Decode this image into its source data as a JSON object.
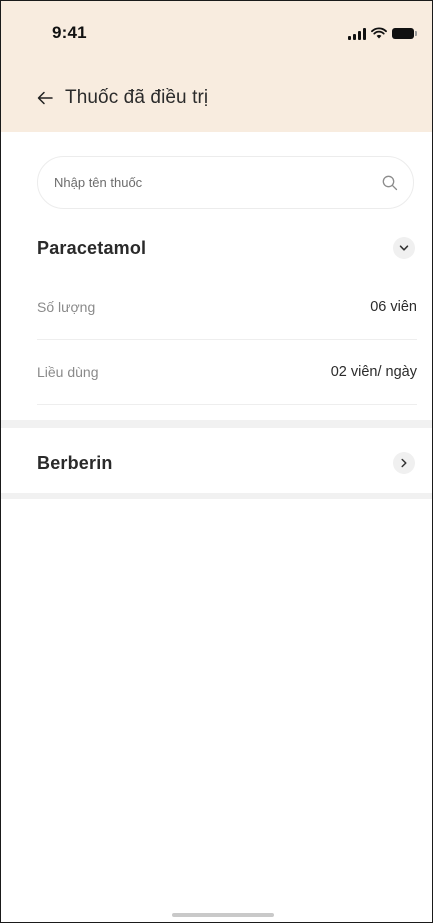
{
  "status_bar": {
    "time": "9:41",
    "icons": [
      "signal-icon",
      "wifi-icon",
      "battery-icon"
    ]
  },
  "header": {
    "back_icon": "arrow-left-icon",
    "title": "Thuốc đã điều trị",
    "background_color": "#f8ecdf"
  },
  "search": {
    "placeholder": "Nhập tên thuốc",
    "value": "",
    "icon": "search-icon"
  },
  "medications": [
    {
      "name": "Paracetamol",
      "expanded": true,
      "toggle_icon": "chevron-down-icon",
      "details": [
        {
          "label": "Số lượng",
          "value": "06 viên"
        },
        {
          "label": "Liều dùng",
          "value": "02 viên/ ngày"
        }
      ]
    },
    {
      "name": "Berberin",
      "expanded": false,
      "toggle_icon": "chevron-right-icon",
      "details": []
    }
  ]
}
